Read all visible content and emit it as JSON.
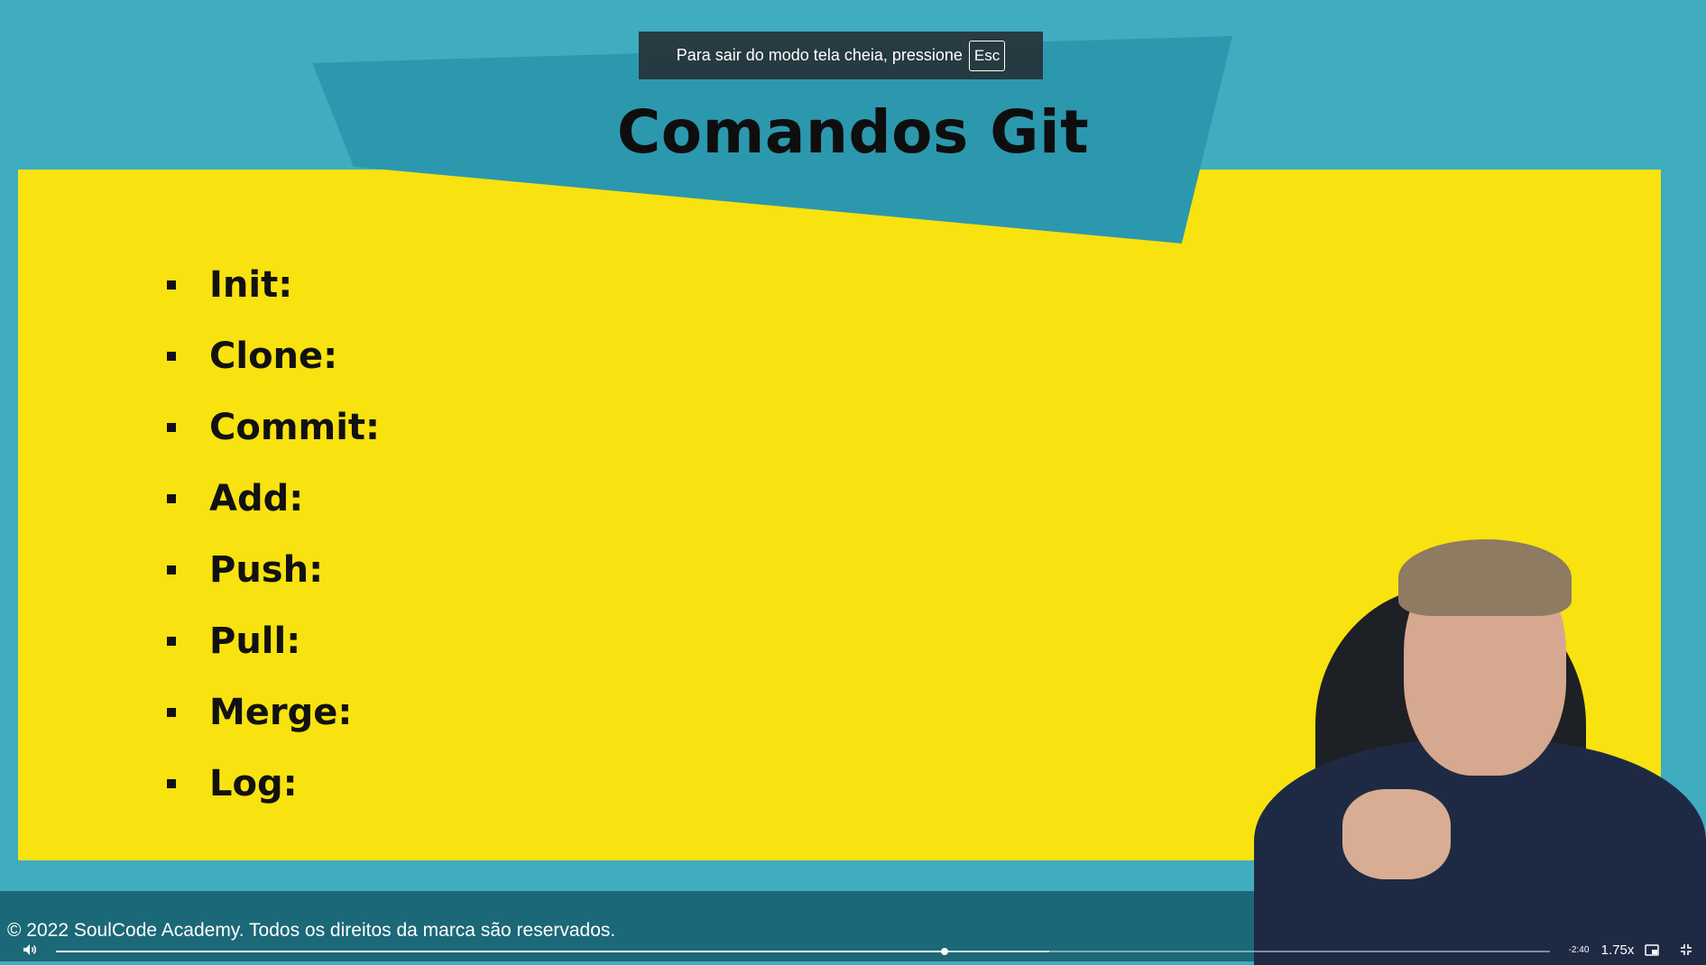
{
  "notice": {
    "text": "Para sair do modo tela cheia, pressione",
    "key": "Esc"
  },
  "slide": {
    "title": "Comandos Git",
    "items": [
      "Init:",
      "Clone:",
      "Commit:",
      "Add:",
      "Push:",
      "Pull:",
      "Merge:",
      "Log:"
    ],
    "copyright": "© 2022 SoulCode Academy. Todos os direitos da marca são reservados."
  },
  "player": {
    "time_remaining": "-2:40",
    "speed": "1.75x",
    "progress": 0.595,
    "buffered": 0.665
  },
  "colors": {
    "background": "#40acbf",
    "banner": "#2c98ae",
    "panel": "#f8e20f",
    "footer": "#1b6878"
  },
  "icons": {
    "volume": "volume-icon",
    "pip": "picture-in-picture-icon",
    "exit_fullscreen": "exit-fullscreen-icon"
  }
}
